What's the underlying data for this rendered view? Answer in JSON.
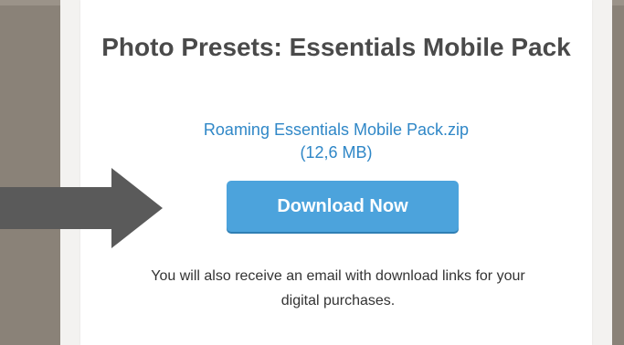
{
  "product_title": "Photo Presets: Essentials Mobile Pack",
  "download": {
    "file_name": "Roaming Essentials Mobile Pack.zip",
    "file_size": "(12,6 MB)",
    "button_label": "Download Now"
  },
  "notice_text": "You will also receive an email with download links for your digital purchases.",
  "icons": {
    "pointer": "arrow-right-icon"
  },
  "colors": {
    "link": "#2f87c7",
    "button": "#4ca3dc",
    "arrow": "#5a5a5a",
    "background": "#8a8278"
  }
}
